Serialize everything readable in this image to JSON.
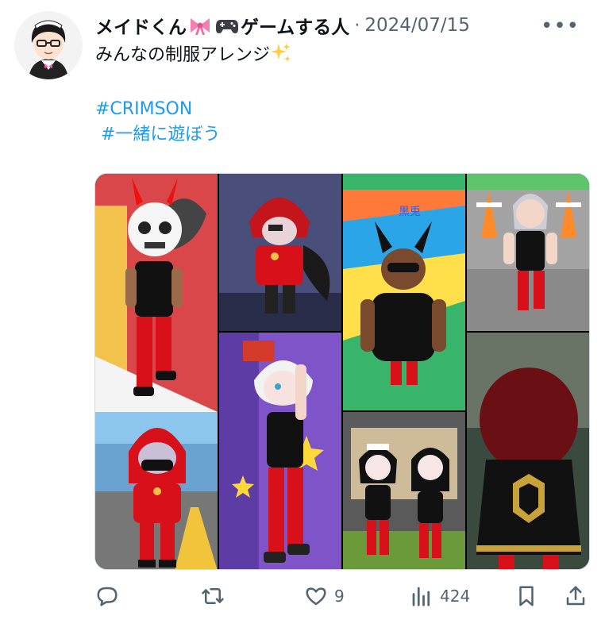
{
  "tweet": {
    "display_name": "メイドくん",
    "name_suffix": "ゲームする人",
    "separator": "·",
    "date": "2024/07/15",
    "more_label": "•••",
    "text_line1": "みんなの制服アレンジ",
    "hashtags": [
      "#CRIMSON",
      "#一緒に遊ぼう"
    ],
    "emojis": [
      "ribbon-emoji",
      "game-controller-emoji",
      "sparkles-emoji"
    ],
    "media_overlay_text": "黒兎"
  },
  "actions": {
    "reply": {
      "icon": "reply-icon",
      "count": ""
    },
    "retweet": {
      "icon": "retweet-icon",
      "count": ""
    },
    "like": {
      "icon": "heart-icon",
      "count": "9"
    },
    "views": {
      "icon": "views-icon",
      "count": "424"
    },
    "bookmark": {
      "icon": "bookmark-icon"
    },
    "share": {
      "icon": "share-icon"
    }
  },
  "colors": {
    "link": "#1d9bf0",
    "secondary_text": "#536471",
    "primary_text": "#0f1419",
    "outfit_red": "#d7101a",
    "outfit_black": "#111111"
  }
}
